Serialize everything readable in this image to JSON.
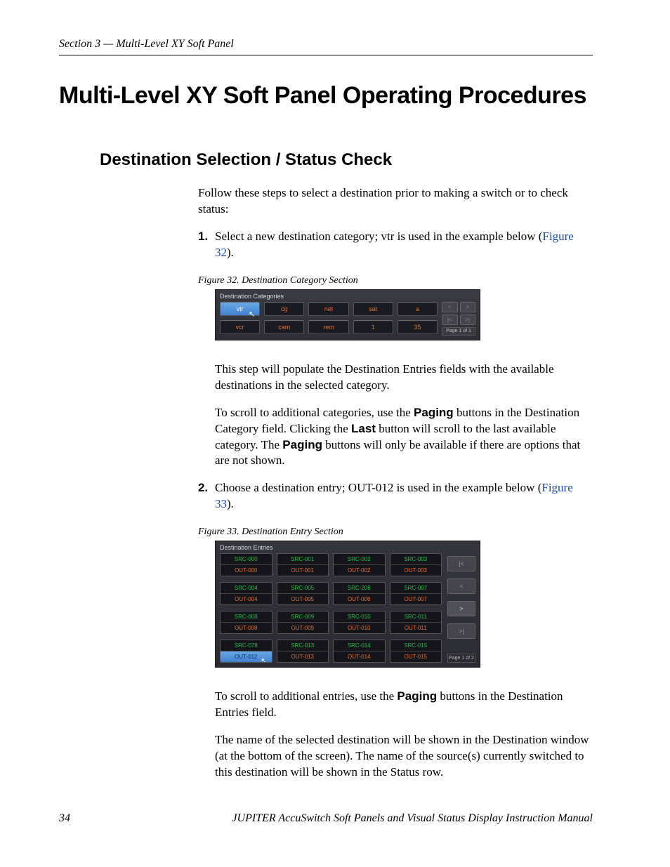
{
  "section_header": "Section 3 — Multi-Level XY Soft Panel",
  "h1": "Multi-Level XY Soft Panel Operating Procedures",
  "h2": "Destination Selection / Status Check",
  "intro": "Follow these steps to select a destination prior to making a switch or to check status:",
  "step1": {
    "num": "1.",
    "text_a": "Select a new destination category; vtr is used in the example below (",
    "link": "Figure 32",
    "text_b": ")."
  },
  "fig32_caption": "Figure 32.  Destination Category Section",
  "fig32": {
    "title": "Destination Categories",
    "row1": [
      "vtr",
      "cg",
      "net",
      "sat",
      "a"
    ],
    "row2": [
      "vcr",
      "cam",
      "rem",
      "1",
      "35"
    ],
    "pagers": {
      "b1": "<",
      "b2": ">",
      "b3": "|<",
      "b4": ">|",
      "label": "Page 1 of 1"
    }
  },
  "para_after_fig32_a": "This step will populate the Destination Entries fields with the available destinations in the selected category.",
  "para_after_fig32_b": {
    "t1": "To scroll to additional categories, use the ",
    "b1": "Paging",
    "t2": " buttons in the Destination Category field. Clicking the ",
    "b2": "Last",
    "t3": " button will scroll to the last available category. The ",
    "b3": "Paging",
    "t4": " buttons will only be available if there are options that are not shown."
  },
  "step2": {
    "num": "2.",
    "text_a": "Choose a destination entry; OUT-012 is used in the example below (",
    "link": "Figure 33",
    "text_b": ")."
  },
  "fig33_caption": "Figure 33.  Destination Entry Section",
  "fig33": {
    "title": "Destination Entries",
    "rows": [
      [
        {
          "src": "SRC-000",
          "out": "OUT-000"
        },
        {
          "src": "SRC-001",
          "out": "OUT-001"
        },
        {
          "src": "SRC-002",
          "out": "OUT-002"
        },
        {
          "src": "SRC-003",
          "out": "OUT-003"
        }
      ],
      [
        {
          "src": "SRC-004",
          "out": "OUT-004"
        },
        {
          "src": "SRC-005",
          "out": "OUT-005"
        },
        {
          "src": "SRC-206",
          "out": "OUT-006"
        },
        {
          "src": "SRC-007",
          "out": "OUT-007"
        }
      ],
      [
        {
          "src": "SRC-008",
          "out": "OUT-008"
        },
        {
          "src": "SRC-009",
          "out": "OUT-009"
        },
        {
          "src": "SRC-010",
          "out": "OUT-010"
        },
        {
          "src": "SRC-011",
          "out": "OUT-011"
        }
      ],
      [
        {
          "src": "SRC-078",
          "out": "OUT-012",
          "sel": true
        },
        {
          "src": "SRC-013",
          "out": "OUT-013"
        },
        {
          "src": "SRC-014",
          "out": "OUT-014"
        },
        {
          "src": "SRC-015",
          "out": "OUT-015"
        }
      ]
    ],
    "pagers": {
      "first": "|<",
      "prev": "<",
      "next": ">",
      "last": ">|",
      "label": "Page 1 of 2"
    }
  },
  "para_after_fig33_a": {
    "t1": "To scroll to additional entries, use the ",
    "b1": "Paging",
    "t2": " buttons in the Destination Entries field."
  },
  "para_after_fig33_b": "The name of the selected destination will be shown in the Destination window (at the bottom of the screen). The name of the source(s) currently switched to this destination will be shown in the Status row.",
  "footer": {
    "page": "34",
    "title": "JUPITER AccuSwitch Soft Panels and Visual Status Display Instruction Manual"
  }
}
